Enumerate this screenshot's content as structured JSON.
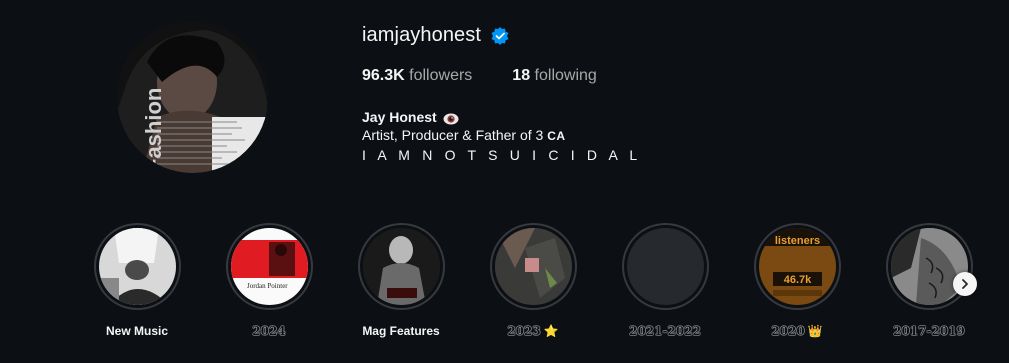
{
  "profile": {
    "username": "iamjayhonest",
    "verified_icon": "verified-badge-icon",
    "followers_count": "96.3K",
    "followers_label": "followers",
    "following_count": "18",
    "following_label": "following",
    "display_name": "Jay Honest",
    "bio_line1": "Artist, Producer & Father of 3",
    "bio_line1_suffix": "CA",
    "bio_line2": "I A M N O T S U I C I D A L",
    "avatar_text": "Fashion"
  },
  "highlights": [
    {
      "label": "New Music",
      "emoji": "",
      "style": "plain"
    },
    {
      "label": "2024",
      "emoji": "",
      "style": "outlined"
    },
    {
      "label": "Mag Features",
      "emoji": "",
      "style": "plain"
    },
    {
      "label": "2023",
      "emoji": "⭐",
      "style": "outlined"
    },
    {
      "label": "2021-2022",
      "emoji": "",
      "style": "outlined"
    },
    {
      "label": "2020",
      "emoji": "👑",
      "style": "outlined"
    },
    {
      "label": "2017-2019",
      "emoji": "",
      "style": "outlined"
    }
  ],
  "highlight_thumb_text": {
    "h2": "Jordan Pointer",
    "h6_top": "listeners",
    "h6_num": "46.7k"
  },
  "colors": {
    "background": "#0c1014",
    "verified_blue": "#0095f6",
    "secondary_text": "#a8a8a8"
  }
}
